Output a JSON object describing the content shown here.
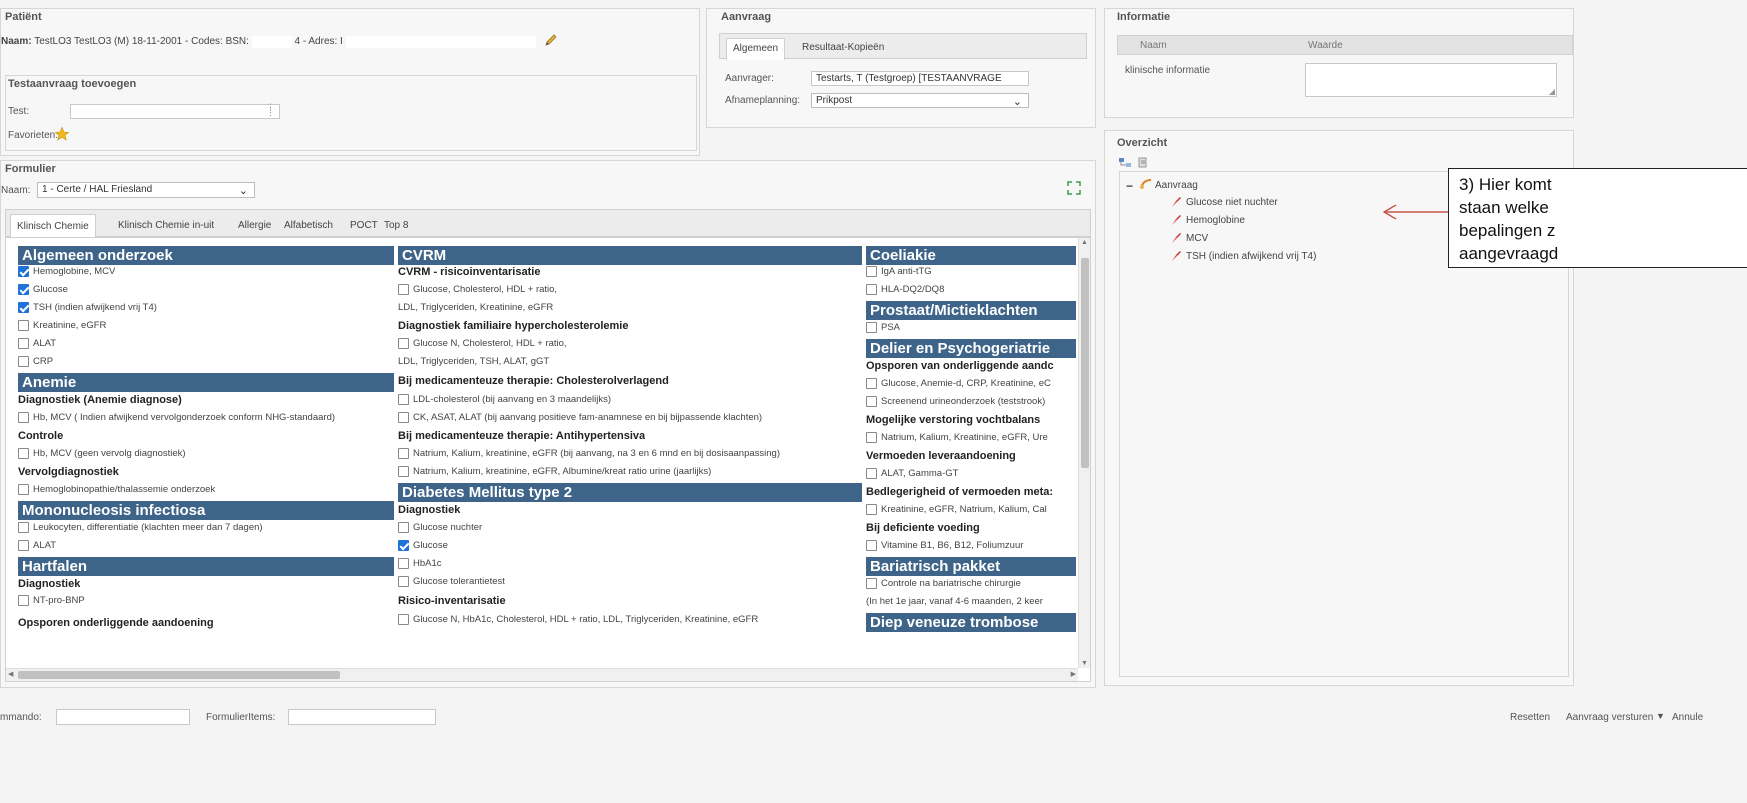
{
  "patient": {
    "title": "Patiënt",
    "naam_label": "Naam:",
    "naam_value": "TestLO3 TestLO3 (M) 18-11-2001 - Codes: BSN:",
    "bsn_tail": "4 - Adres: I",
    "edit_icon": "pencil-icon"
  },
  "testaanvraag": {
    "title": "Testaanvraag toevoegen",
    "test_label": "Test:",
    "test_value": "",
    "favorieten_label": "Favorieten:",
    "star_icon": "star-icon"
  },
  "aanvraag": {
    "title": "Aanvraag",
    "tabs": [
      "Algemeen",
      "Resultaat-Kopieën"
    ],
    "aanvrager_label": "Aanvrager:",
    "aanvrager_value": "Testarts, T (Testgroep) [TESTAANVRAGE",
    "afnameplanning_label": "Afnameplanning:",
    "afnameplanning_value": "Prikpost"
  },
  "informatie": {
    "title": "Informatie",
    "col_naam": "Naam",
    "col_waarde": "Waarde",
    "row_label": "klinische informatie",
    "row_value": ""
  },
  "overzicht": {
    "title": "Overzicht",
    "root": "Aanvraag",
    "items": [
      "Glucose niet nuchter",
      "Hemoglobine",
      "MCV",
      "TSH (indien afwijkend vrij T4)"
    ]
  },
  "annotation": {
    "lines": [
      "3) Hier komt",
      "staan welke",
      "bepalingen z",
      "aangevraagd"
    ],
    "arrow_color": "#c0392b"
  },
  "formulier": {
    "title": "Formulier",
    "naam_label": "Naam:",
    "naam_value": "1 - Certe / HAL Friesland",
    "tabs": [
      "Klinisch Chemie",
      "Klinisch Chemie in-uit",
      "Allergie",
      "Alfabetisch",
      "POCT",
      "Top 8"
    ],
    "col1": {
      "h_algemeen": "Algemeen onderzoek",
      "hemoglobine_mcv": "Hemoglobine, MCV",
      "glucose": "Glucose",
      "tsh": "TSH (indien afwijkend vrij T4)",
      "kreatinine": "Kreatinine, eGFR",
      "alat": "ALAT",
      "crp": "CRP",
      "h_anemie": "Anemie",
      "s_diag_anemie": "Diagnostiek (Anemie diagnose)",
      "hb_mcv_nhg": "Hb, MCV ( Indien afwijkend vervolgonderzoek conform NHG-standaard)",
      "s_controle": "Controle",
      "hb_mcv_geen": "Hb, MCV (geen vervolg diagnostiek)",
      "s_vervolg": "Vervolgdiagnostiek",
      "hemoglobinopathie": "Hemoglobinopathie/thalassemie onderzoek",
      "h_mono": "Mononucleosis infectiosa",
      "leukocyten": "Leukocyten, differentiatie (klachten meer dan 7 dagen)",
      "alat2": "ALAT",
      "h_hartfalen": "Hartfalen",
      "s_diagnostiek": "Diagnostiek",
      "ntprobnp": "NT-pro-BNP",
      "s_opsporen": "Opsporen onderliggende aandoening"
    },
    "col2": {
      "h_cvrm": "CVRM",
      "s_risico": "CVRM - risicoinventarisatie",
      "glucose_chol": "Glucose, Cholesterol, HDL + ratio,",
      "ldl1": "LDL, Triglyceriden, Kreatinine, eGFR",
      "s_familiaire": "Diagnostiek familiaire hypercholesterolemie",
      "glucose_n_chol": "Glucose N, Cholesterol, HDL + ratio,",
      "ldl2": "LDL, Triglyceriden, TSH, ALAT, gGT",
      "s_bij_chol": "Bij medicamenteuze therapie: Cholesterolverlagend",
      "ldl_chol": "LDL-cholesterol (bij aanvang en 3 maandelijks)",
      "ck_asat": "CK, ASAT, ALAT (bij aanvang positieve fam-anamnese en bij bijpassende klachten)",
      "s_bij_anti": "Bij medicamenteuze therapie: Antihypertensiva",
      "natrium1": "Natrium, Kalium, kreatinine, eGFR (bij aanvang, na 3 en 6 mnd en bij dosisaanpassing)",
      "natrium2": "Natrium, Kalium, kreatinine, eGFR, Albumine/kreat ratio urine (jaarlijks)",
      "h_diabetes": "Diabetes Mellitus type 2",
      "s_diagnostiek": "Diagnostiek",
      "glucose_nuchter": "Glucose nuchter",
      "glucose": "Glucose",
      "hba1c": "HbA1c",
      "glucose_tol": "Glucose tolerantietest",
      "s_risico_inv": "Risico-inventarisatie",
      "glucose_n_hba1c": "Glucose N, HbA1c, Cholesterol, HDL + ratio, LDL, Triglyceriden, Kreatinine, eGFR"
    },
    "col3": {
      "h_coeliakie": "Coeliakie",
      "iga": "IgA anti-tTG",
      "hla": "HLA-DQ2/DQ8",
      "h_prostaat": "Prostaat/Mictieklachten",
      "psa": "PSA",
      "h_delier": "Delier en Psychogeriatrie",
      "s_opsporen": "Opsporen van onderliggende aandc",
      "glucose_anemie": "Glucose, Anemie-d, CRP, Kreatinine, eC",
      "screenend": "Screenend urineonderzoek (teststrook)",
      "s_mogelijke": "Mogelijke verstoring vochtbalans",
      "natrium": "Natrium, Kalium, Kreatinine, eGFR, Ure",
      "s_vermoeden": "Vermoeden leveraandoening",
      "alat_ggt": "ALAT, Gamma-GT",
      "s_bedlegerig": "Bedlegerigheid of vermoeden meta:",
      "kreat_egfr": "Kreatinine, eGFR, Natrium, Kalium, Cal",
      "s_deficiente": "Bij deficiente voeding",
      "vitamine": "Vitamine B1, B6, B12, Foliumzuur",
      "h_bariatrisch": "Bariatrisch pakket",
      "controle_bar": "Controle na bariatrische chirurgie",
      "in_het": "(In het 1e jaar, vanaf 4-6 maanden, 2 keer",
      "h_diep": "Diep veneuze trombose"
    }
  },
  "footer": {
    "commando_label": "mmando:",
    "formulieritems_label": "FormulierItems:",
    "resetten": "Resetten",
    "versturen": "Aanvraag versturen",
    "annuleren": "Annule"
  },
  "colors": {
    "section_header": "#3e6589",
    "checkbox_checked": "#1f73d8"
  }
}
